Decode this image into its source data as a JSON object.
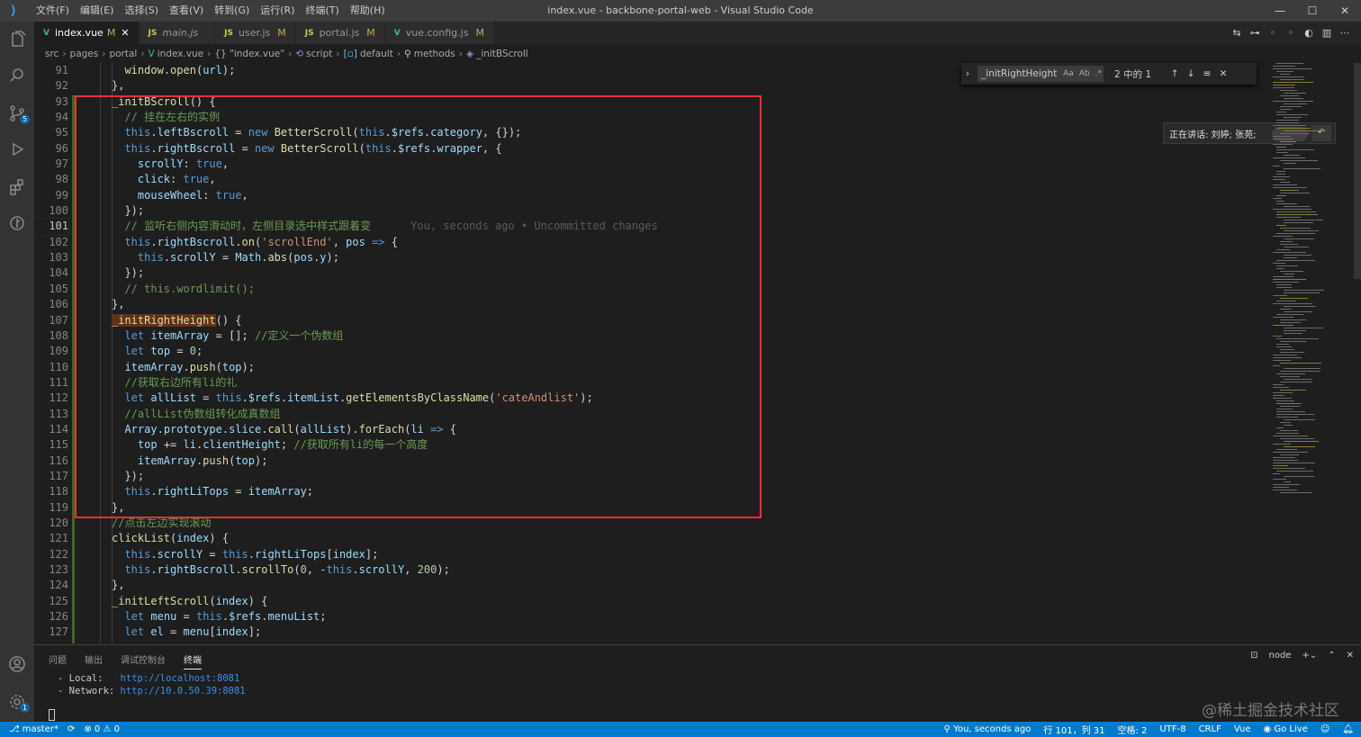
{
  "window": {
    "title": "index.vue - backbone-portal-web - Visual Studio Code",
    "menu": [
      "文件(F)",
      "编辑(E)",
      "选择(S)",
      "查看(V)",
      "转到(G)",
      "运行(R)",
      "终端(T)",
      "帮助(H)"
    ],
    "controls": {
      "minimize": "—",
      "maximize": "☐",
      "close": "✕"
    }
  },
  "activity": {
    "scm_badge": "5",
    "settings_badge": "1"
  },
  "tabs": [
    {
      "icon": "V",
      "icon_kind": "vue",
      "label": "index.vue",
      "status": "M",
      "active": true,
      "close": "✕"
    },
    {
      "icon": "JS",
      "icon_kind": "js",
      "label": "main.js",
      "status": "",
      "active": false
    },
    {
      "icon": "JS",
      "icon_kind": "js",
      "label": "user.js",
      "status": "M",
      "active": false
    },
    {
      "icon": "JS",
      "icon_kind": "js",
      "label": "portal.js",
      "status": "M",
      "active": false
    },
    {
      "icon": "V",
      "icon_kind": "vue",
      "label": "vue.config.js",
      "status": "M",
      "active": false
    }
  ],
  "breadcrumb": [
    "src",
    "pages",
    "portal",
    "index.vue",
    "{} \"index.vue\"",
    "script",
    "default",
    "methods",
    "_initBScroll"
  ],
  "find_widget": {
    "query": "_initRightHeight",
    "opt_case": "Aa",
    "opt_word": "Ab",
    "opt_regex": ".*",
    "result": "2 中的 1"
  },
  "talk_popup": {
    "text": "正在讲话: 刘婷; 张苑;"
  },
  "blame": "You, seconds ago • Uncommitted changes",
  "code_lines": [
    {
      "n": "91",
      "t": "  window.open(url);"
    },
    {
      "n": "92",
      "t": "},"
    },
    {
      "n": "93",
      "t": "_initBScroll() {"
    },
    {
      "n": "94",
      "t": "  // 挂在左右的实例"
    },
    {
      "n": "95",
      "t": "  this.leftBscroll = new BetterScroll(this.$refs.category, {});"
    },
    {
      "n": "96",
      "t": "  this.rightBscroll = new BetterScroll(this.$refs.wrapper, {"
    },
    {
      "n": "97",
      "t": "    scrollY: true,"
    },
    {
      "n": "98",
      "t": "    click: true,"
    },
    {
      "n": "99",
      "t": "    mouseWheel: true,"
    },
    {
      "n": "100",
      "t": "  });"
    },
    {
      "n": "101",
      "t": "  // 监听右侧内容滑动时, 左侧目录选中样式跟着变"
    },
    {
      "n": "102",
      "t": "  this.rightBscroll.on('scrollEnd', pos => {"
    },
    {
      "n": "103",
      "t": "    this.scrollY = Math.abs(pos.y);"
    },
    {
      "n": "104",
      "t": "  });"
    },
    {
      "n": "105",
      "t": "  // this.wordlimit();"
    },
    {
      "n": "106",
      "t": "},"
    },
    {
      "n": "107",
      "t": "_initRightHeight() {"
    },
    {
      "n": "108",
      "t": "  let itemArray = []; //定义一个伪数组"
    },
    {
      "n": "109",
      "t": "  let top = 0;"
    },
    {
      "n": "110",
      "t": "  itemArray.push(top);"
    },
    {
      "n": "111",
      "t": "  //获取右边所有li的礼"
    },
    {
      "n": "112",
      "t": "  let allList = this.$refs.itemList.getElementsByClassName('cateAndlist');"
    },
    {
      "n": "113",
      "t": "  //allList伪数组转化成真数组"
    },
    {
      "n": "114",
      "t": "  Array.prototype.slice.call(allList).forEach(li => {"
    },
    {
      "n": "115",
      "t": "    top += li.clientHeight; //获取所有li的每一个高度"
    },
    {
      "n": "116",
      "t": "    itemArray.push(top);"
    },
    {
      "n": "117",
      "t": "  });"
    },
    {
      "n": "118",
      "t": "  this.rightLiTops = itemArray;"
    },
    {
      "n": "119",
      "t": "},"
    },
    {
      "n": "120",
      "t": "//点击左边实现滚动"
    },
    {
      "n": "121",
      "t": "clickList(index) {"
    },
    {
      "n": "122",
      "t": "  this.scrollY = this.rightLiTops[index];"
    },
    {
      "n": "123",
      "t": "  this.rightBscroll.scrollTo(0, -this.scrollY, 200);"
    },
    {
      "n": "124",
      "t": "},"
    },
    {
      "n": "125",
      "t": "_initLeftScroll(index) {"
    },
    {
      "n": "126",
      "t": "  let menu = this.$refs.menuList;"
    },
    {
      "n": "127",
      "t": "  let el = menu[index];"
    }
  ],
  "panel": {
    "tabs": [
      "问题",
      "输出",
      "调试控制台",
      "终端"
    ],
    "active_tab": "终端",
    "terminal_name": "node",
    "terminal": [
      {
        "label": "- Local:   ",
        "url": "http://localhost:8081"
      },
      {
        "label": "- Network: ",
        "url": "http://10.0.50.39:8081"
      }
    ]
  },
  "watermark": "@稀土掘金技术社区",
  "statusbar": {
    "branch": "master*",
    "sync": "⟳",
    "problems": "⊗ 0 ⚠ 0",
    "blame": "You, seconds ago",
    "position": "行 101，列 31",
    "spaces": "空格: 2",
    "encoding": "UTF-8",
    "eol": "CRLF",
    "language": "Vue",
    "golive": "Go Live"
  }
}
